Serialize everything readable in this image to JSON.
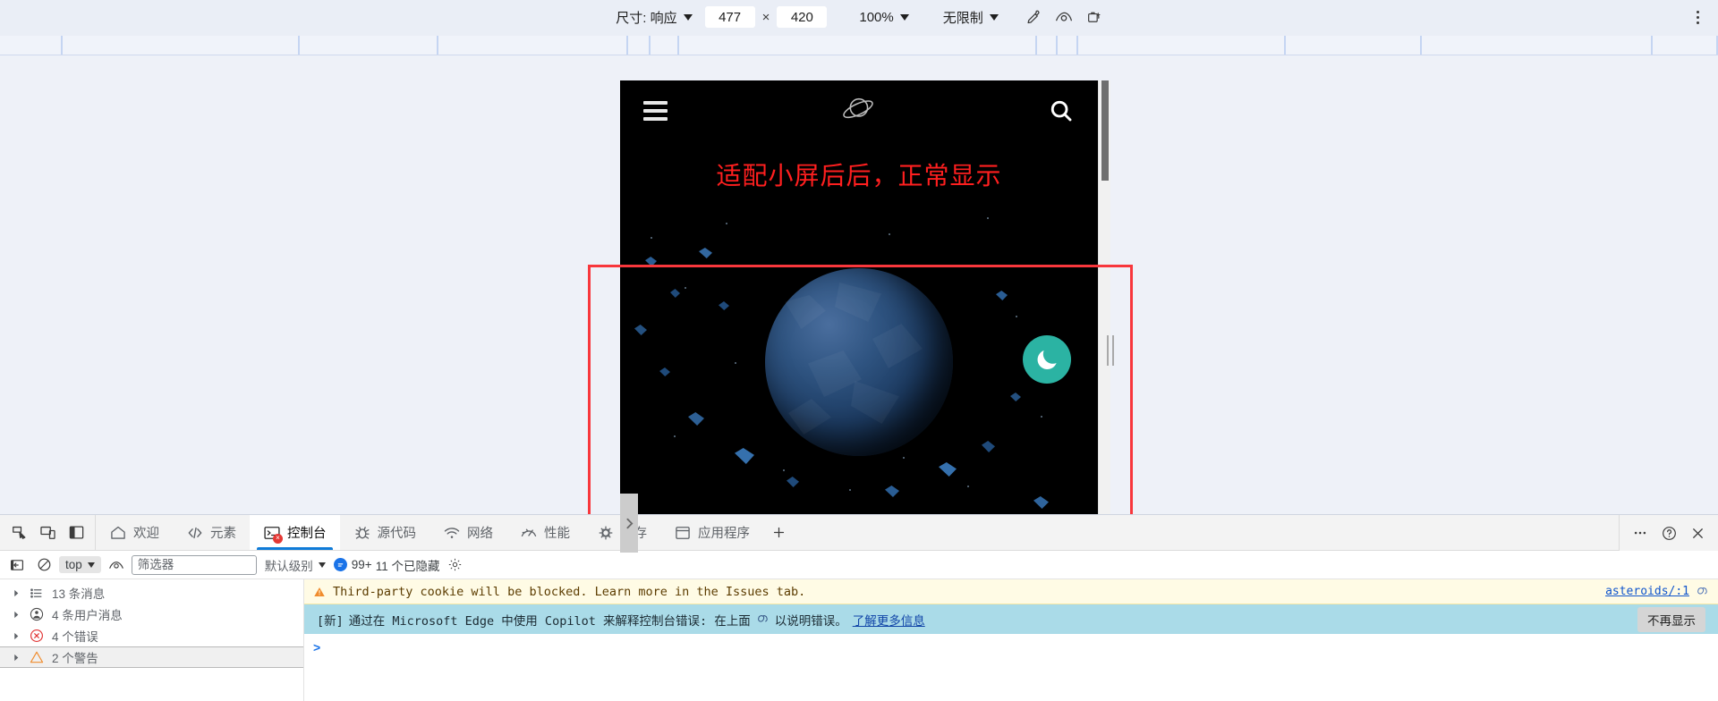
{
  "device_toolbar": {
    "size_label": "尺寸: 响应",
    "width_value": "477",
    "height_value": "420",
    "separator": "×",
    "zoom_label": "100%",
    "throttle_label": "无限制",
    "icons": {
      "eyedropper": "eyedropper-icon",
      "vision_deficiency": "vision-deficiency-icon",
      "screenshot": "rotate-screenshot-icon",
      "more": "more-options-icon"
    }
  },
  "page_preview": {
    "hamburger": "menu-icon",
    "logo": "planet-logo-icon",
    "search": "search-icon",
    "banner_text": "适配小屏后后，正常显示",
    "dark_mode_toggle": "moon-icon"
  },
  "devtools": {
    "left_icons": [
      "inspect-element-icon",
      "device-toolbar-icon",
      "dock-side-icon"
    ],
    "tabs": [
      {
        "label": "欢迎",
        "icon": "home-icon",
        "active": false
      },
      {
        "label": "元素",
        "icon": "code-brackets-icon",
        "active": false
      },
      {
        "label": "控制台",
        "icon": "console-terminal-icon",
        "active": true,
        "error_badge": "×"
      },
      {
        "label": "源代码",
        "icon": "bug-sources-icon",
        "active": false
      },
      {
        "label": "网络",
        "icon": "wifi-network-icon",
        "active": false
      },
      {
        "label": "性能",
        "icon": "gauge-performance-icon",
        "active": false
      },
      {
        "label": "内存",
        "icon": "cpu-memory-icon",
        "active": false
      },
      {
        "label": "应用程序",
        "icon": "window-application-icon",
        "active": false
      }
    ],
    "add_tab": "+",
    "right_icons": [
      "more-tools-icon",
      "help-question-icon",
      "close-devtools-icon"
    ]
  },
  "console_toolbar": {
    "sidebar_toggle": "show-console-sidebar-icon",
    "clear_console": "clear-console-icon",
    "context_selector": "top",
    "live_expression": "eye-live-expression-icon",
    "filter_placeholder": "筛选器",
    "filter_value": "",
    "level_label": "默认级别",
    "message_count": "99+",
    "hidden_label": "11 个已隐藏",
    "settings": "settings-gear-icon"
  },
  "console_sidebar": {
    "rows": [
      {
        "label": "13 条消息",
        "icon": "list-messages-icon",
        "selected": false
      },
      {
        "label": "4 条用户消息",
        "icon": "user-message-icon",
        "selected": false
      },
      {
        "label": "4 个错误",
        "icon": "error-circle-icon",
        "selected": false
      },
      {
        "label": "2 个警告",
        "icon": "warning-triangle-icon",
        "selected": true
      }
    ]
  },
  "console_messages": {
    "warning": {
      "icon": "warning-triangle-icon",
      "text": "Third-party cookie will be blocked. Learn more in the Issues tab.",
      "source": "asteroids/:1",
      "source_icon": "copilot-icon"
    },
    "copilot_banner": {
      "prefix": "[新]",
      "text": "通过在 Microsoft Edge 中使用 Copilot 来解释控制台错误: 在上面",
      "inline_icon": "copilot-icon",
      "text_after": "以说明错误。",
      "link": "了解更多信息",
      "dismiss_label": "不再显示"
    },
    "prompt_caret": ">"
  },
  "colors": {
    "accent_blue": "#0f7bd8",
    "highlight_red": "#f8373c",
    "banner_red": "#ff1f1f",
    "toggle_teal": "#2bb3a3",
    "warning_bg": "#fffbe5",
    "copilot_bg": "#aadbe8",
    "toolbar_bg": "#eaeef6"
  }
}
